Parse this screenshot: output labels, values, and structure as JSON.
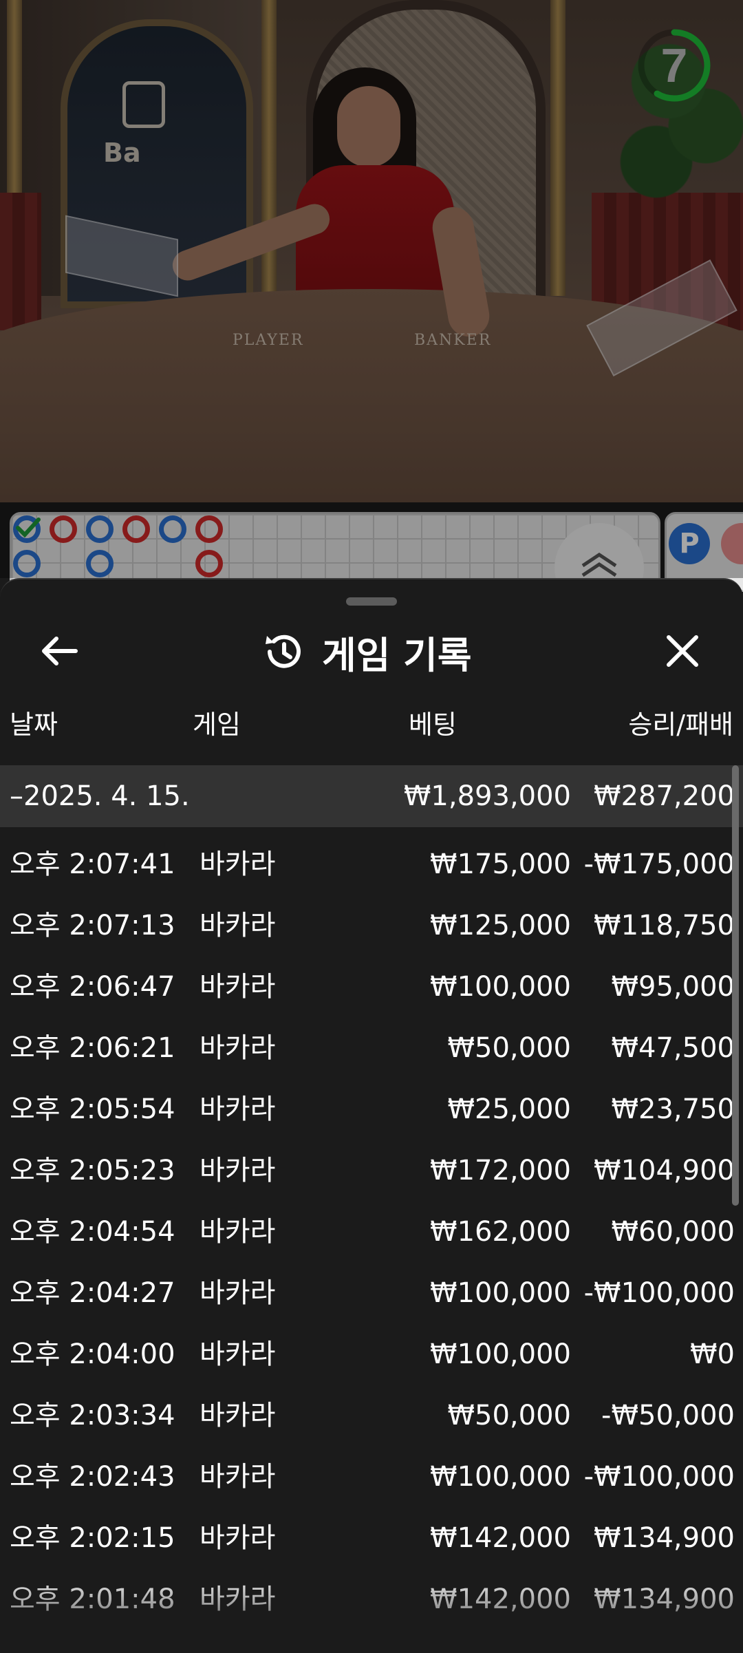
{
  "video": {
    "timer_value": "7",
    "table_labels": {
      "player": "PLAYER",
      "banker": "BANKER"
    },
    "logo_text": "Ba"
  },
  "roadmap": {
    "side_badge_p": "P"
  },
  "sheet": {
    "title": "게임 기록",
    "icons": {
      "back": "arrow-left-icon",
      "history": "history-clock-icon",
      "close": "close-x-icon"
    },
    "columns": {
      "date": "날짜",
      "game": "게임",
      "bet": "베팅",
      "result": "승리/패배"
    },
    "date_group": {
      "label": "–2025. 4. 15.",
      "bet_total": "₩1,893,000",
      "result_total": "₩287,200"
    },
    "rows": [
      {
        "time": "오후 2:07:41",
        "game": "바카라",
        "bet": "₩175,000",
        "result": "-₩175,000"
      },
      {
        "time": "오후 2:07:13",
        "game": "바카라",
        "bet": "₩125,000",
        "result": "₩118,750"
      },
      {
        "time": "오후 2:06:47",
        "game": "바카라",
        "bet": "₩100,000",
        "result": "₩95,000"
      },
      {
        "time": "오후 2:06:21",
        "game": "바카라",
        "bet": "₩50,000",
        "result": "₩47,500"
      },
      {
        "time": "오후 2:05:54",
        "game": "바카라",
        "bet": "₩25,000",
        "result": "₩23,750"
      },
      {
        "time": "오후 2:05:23",
        "game": "바카라",
        "bet": "₩172,000",
        "result": "₩104,900"
      },
      {
        "time": "오후 2:04:54",
        "game": "바카라",
        "bet": "₩162,000",
        "result": "₩60,000"
      },
      {
        "time": "오후 2:04:27",
        "game": "바카라",
        "bet": "₩100,000",
        "result": "-₩100,000"
      },
      {
        "time": "오후 2:04:00",
        "game": "바카라",
        "bet": "₩100,000",
        "result": "₩0"
      },
      {
        "time": "오후 2:03:34",
        "game": "바카라",
        "bet": "₩50,000",
        "result": "-₩50,000"
      },
      {
        "time": "오후 2:02:43",
        "game": "바카라",
        "bet": "₩100,000",
        "result": "-₩100,000"
      },
      {
        "time": "오후 2:02:15",
        "game": "바카라",
        "bet": "₩142,000",
        "result": "₩134,900"
      },
      {
        "time": "오후 2:01:48",
        "game": "바카라",
        "bet": "₩142,000",
        "result": "₩134,900"
      }
    ]
  },
  "colors": {
    "sheet_bg": "#1b1b1b",
    "date_row_bg": "#333333",
    "timer_ring": "#1fbf3a",
    "player_blue": "#2a6fd0",
    "banker_red": "#d02a2a"
  }
}
